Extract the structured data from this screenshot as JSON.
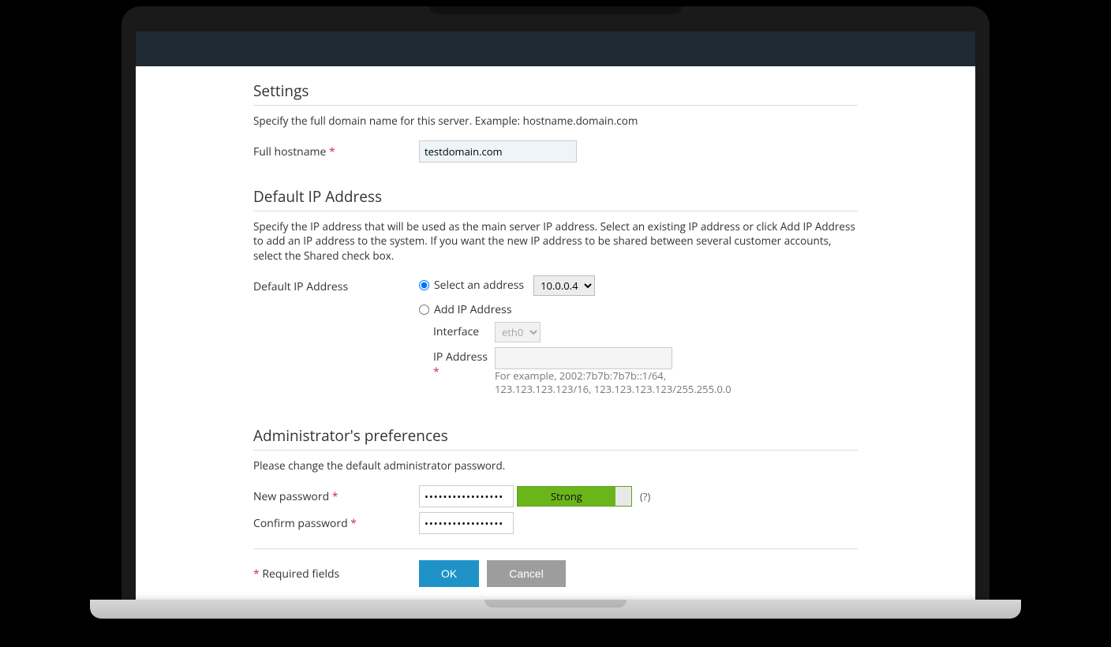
{
  "settings": {
    "title": "Settings",
    "desc": "Specify the full domain name for this server. Example: hostname.domain.com",
    "hostname_label": "Full hostname",
    "hostname_value": "testdomain.com"
  },
  "default_ip": {
    "title": "Default IP Address",
    "desc": "Specify the IP address that will be used as the main server IP address. Select an existing IP address or click Add IP Address to add an IP address to the system. If you want the new IP address to be shared between several customer accounts, select the Shared check box.",
    "label": "Default IP Address",
    "radio_select_label": "Select an address",
    "select_value": "10.0.0.4",
    "radio_add_label": "Add IP Address",
    "interface_label": "Interface",
    "interface_value": "eth0",
    "ip_label": "IP Address",
    "ip_hint": "For example, 2002:7b7b:7b7b::1/64, 123.123.123.123/16, 123.123.123.123/255.255.0.0"
  },
  "admin_prefs": {
    "title": "Administrator's preferences",
    "desc": "Please change the default administrator password.",
    "new_pw_label": "New password",
    "confirm_pw_label": "Confirm password",
    "pw_mask": "●●●●●●●●●●●●●●●●●",
    "strength_label": "Strong",
    "help": "(?)"
  },
  "footer": {
    "required_note": "Required fields",
    "ok": "OK",
    "cancel": "Cancel"
  }
}
